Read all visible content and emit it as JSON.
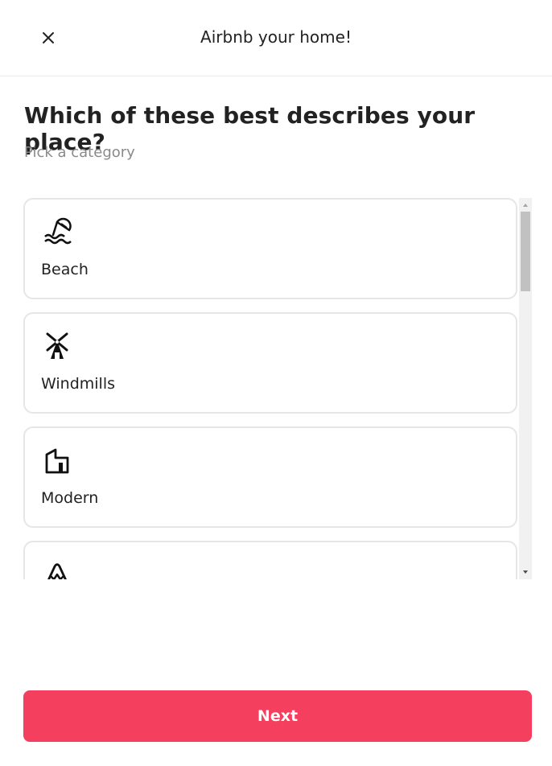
{
  "header": {
    "title": "Airbnb your home!",
    "close_icon": "close-icon"
  },
  "main": {
    "heading": "Which of these best describes your place?",
    "subheading": "Pick a category"
  },
  "categories": [
    {
      "label": "Beach",
      "icon": "beach-umbrella-icon",
      "selected": false
    },
    {
      "label": "Windmills",
      "icon": "windmill-icon",
      "selected": false
    },
    {
      "label": "Modern",
      "icon": "modern-house-icon",
      "selected": false
    },
    {
      "label": "",
      "icon": "mountain-icon",
      "selected": false
    }
  ],
  "footer": {
    "next_label": "Next"
  },
  "colors": {
    "accent": "#f43f5e",
    "border": "#e6e6e6",
    "muted_text": "#8a8a8a"
  }
}
